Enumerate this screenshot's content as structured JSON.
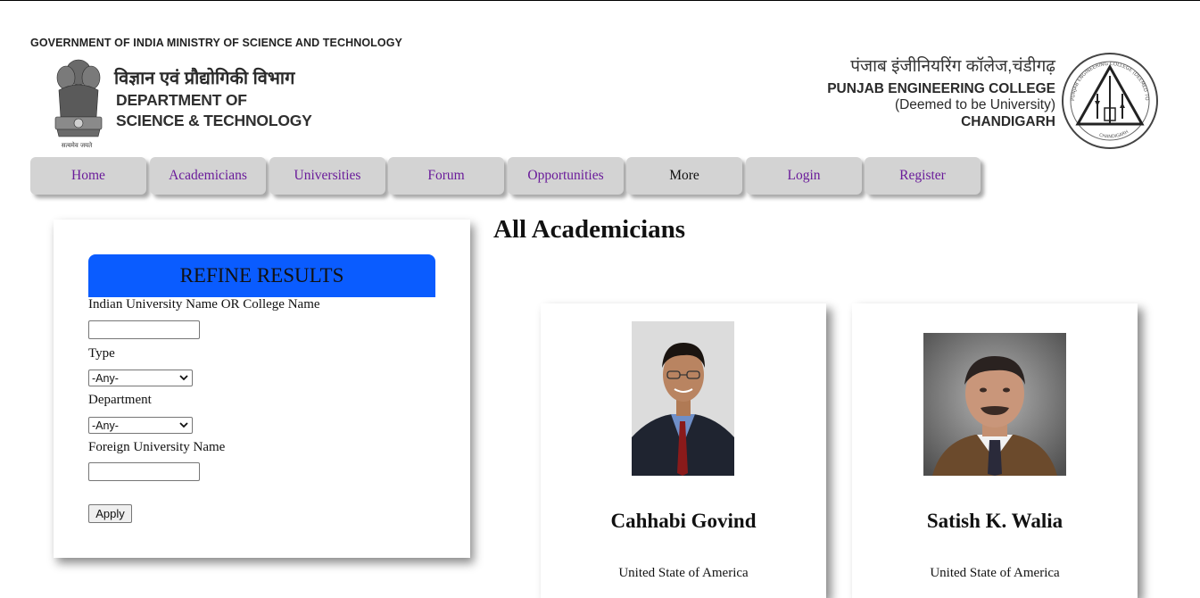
{
  "header": {
    "gov_line": "GOVERNMENT OF INDIA   MINISTRY OF SCIENCE AND TECHNOLOGY",
    "dst_hindi": "विज्ञान एवं प्रौद्योगिकी विभाग",
    "dst_en_line1": "DEPARTMENT OF",
    "dst_en_line2": "SCIENCE & TECHNOLOGY",
    "emblem_motto": "सत्यमेव जयते",
    "pec_hindi": "पंजाब इंजीनियरिंग कॉलेज,चंडीगढ़",
    "pec_en_line1": "PUNJAB ENGINEERING COLLEGE",
    "pec_en_line2": "(Deemed to be University)",
    "pec_en_line3": "CHANDIGARH",
    "pec_seal_text": "PUNJAB ENGINEERING COLLEGE (DEEMED TO BE UNIVERSITY)",
    "pec_seal_bottom": "CHANDIGARH"
  },
  "nav": {
    "items": [
      {
        "label": "Home"
      },
      {
        "label": "Academicians"
      },
      {
        "label": "Universities"
      },
      {
        "label": "Forum"
      },
      {
        "label": "Opportunities"
      },
      {
        "label": "More"
      },
      {
        "label": "Login"
      },
      {
        "label": "Register"
      }
    ]
  },
  "refine": {
    "title": "REFINE RESULTS",
    "university_label": "Indian University Name OR College Name",
    "university_value": "",
    "type_label": "Type",
    "type_selected": "-Any-",
    "department_label": "Department",
    "department_selected": "-Any-",
    "foreign_label": "Foreign University Name",
    "foreign_value": "",
    "apply_label": "Apply"
  },
  "main": {
    "title": "All Academicians",
    "cards": [
      {
        "name": "Cahhabi Govind",
        "country": "United State of America"
      },
      {
        "name": "Satish K. Walia",
        "country": "United State of America"
      }
    ]
  },
  "colors": {
    "refine_header": "#0a5cff",
    "nav_bg": "#d3d3d3",
    "nav_link": "#6a1b9a"
  }
}
